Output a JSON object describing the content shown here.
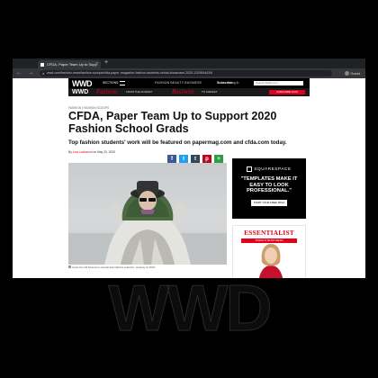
{
  "browser": {
    "tab_title": "CFDA, Paper Team Up to Supp",
    "tab_close": "×",
    "new_tab": "+",
    "nav_icons": "← → ↻",
    "url": "wwd.com/fashion-news/fashion-scoops/cfda-paper-magazine-fashion-students-virtual-showcase-2020-1203644434/",
    "profile": "Guest",
    "colors": {
      "close": "#ff5f57",
      "minimize": "#febc2e",
      "maximize": "#28c840"
    }
  },
  "nav": {
    "logo": "WWD",
    "sections": "SECTIONS",
    "categories": "FASHION  BEAUTY  BUSINESS",
    "subscribe": "Subscribe",
    "login": "Log In",
    "search_placeholder": "Search WWD.com",
    "search_icon": "search-icon"
  },
  "banner": {
    "logo": "WWD",
    "fashion": "Fashion",
    "fashion_sub": "FROM THE RUNWAY",
    "business": "Business",
    "business_sub": "TO MARKET",
    "cta": "SUBSCRIBE NOW"
  },
  "article": {
    "breadcrumb": "FASHION  |  FASHION SCOOPS",
    "headline": "CFDA, Paper Team Up to Support 2020 Fashion School Grads",
    "dek": "Top fashion students' work will be featured on papermag.com and cfda.com today.",
    "byline_prefix": "By ",
    "author": "Lisa Lockwood",
    "date": " on May 20, 2020",
    "caption_icon": "camera-icon",
    "caption": "A look from Eli Sorensen's Central Saint Martins collection. Courtesy of CFDA"
  },
  "social": [
    {
      "name": "facebook-share-button",
      "glyph": "f",
      "color": "#3b5998"
    },
    {
      "name": "twitter-share-button",
      "glyph": "t",
      "color": "#1da1f2"
    },
    {
      "name": "tumblr-share-button",
      "glyph": "t",
      "color": "#35465c"
    },
    {
      "name": "pinterest-share-button",
      "glyph": "p",
      "color": "#bd081c"
    },
    {
      "name": "more-share-button",
      "glyph": "+",
      "color": "#2e9e4a"
    }
  ],
  "ads": {
    "squarespace_brand": "SQUARESPACE",
    "squarespace_headline": "\"TEMPLATES MAKE IT EASY TO LOOK PROFESSIONAL.\"",
    "squarespace_cta": "START YOUR FREE TRIAL",
    "essentialist_title": "ESSENTIALIST",
    "essentialist_cta": "TODAY'S MUST READ"
  },
  "footer_logo": "WWD",
  "accent": "#e2001a"
}
